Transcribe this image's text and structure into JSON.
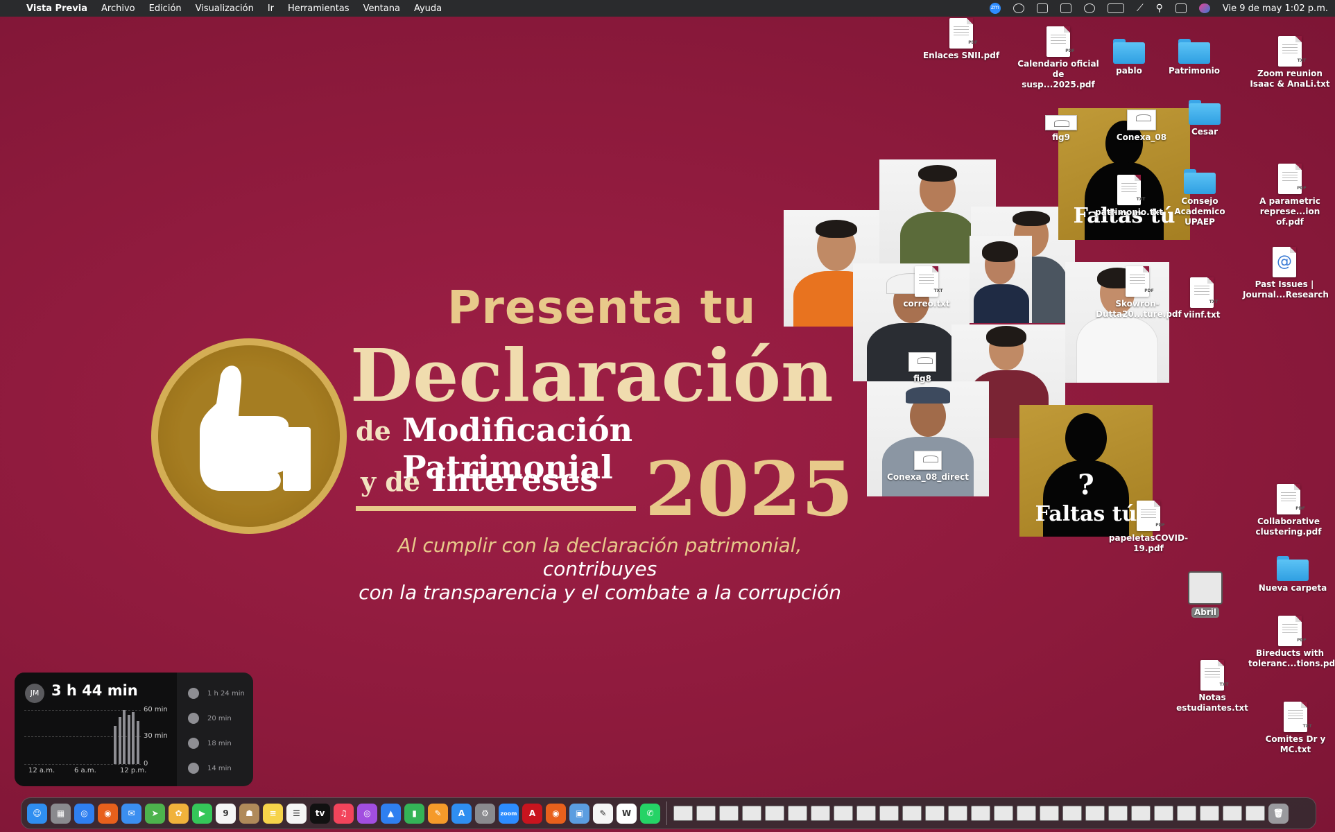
{
  "menubar": {
    "app_name": "Vista Previa",
    "menus": [
      "Archivo",
      "Edición",
      "Visualización",
      "Ir",
      "Herramientas",
      "Ventana",
      "Ayuda"
    ],
    "clock": "Vie 9 de may  1:02 p.m.",
    "status_icons": [
      "zoom-icon",
      "grammarly-icon",
      "sync-icon",
      "reader-icon",
      "play-icon",
      "battery-icon",
      "wifi-off-icon",
      "search-icon",
      "control-center-icon",
      "siri-icon"
    ]
  },
  "wallpaper": {
    "presenta": "Presenta tu",
    "declaracion": "Declaración",
    "de": "de",
    "modificacion": "Modificación Patrimonial",
    "y_de": "y de",
    "intereses": "Intereses",
    "year": "2025",
    "subtitle_gold": "Al cumplir con la declaración patrimonial,",
    "subtitle_white1": " contribuyes",
    "subtitle_white2": "con la transparencia y el combate a la corrupción",
    "faltas_1": "Faltas tú",
    "faltas_2": "Faltas tú",
    "question": "?",
    "colors": {
      "background": "#8f1a3d",
      "gold": "#e8c98a",
      "panel_gold": "#b08a2c"
    }
  },
  "desktop_icons": [
    {
      "label": "Enlaces SNII.pdf",
      "type": "pdf"
    },
    {
      "label": "Calendario oficial de susp...2025.pdf",
      "type": "pdf"
    },
    {
      "label": "pablo",
      "type": "folder"
    },
    {
      "label": "Patrimonio",
      "type": "folder"
    },
    {
      "label": "Zoom reunion Isaac & AnaLi.txt",
      "type": "txt"
    },
    {
      "label": "fig9",
      "type": "image"
    },
    {
      "label": "Conexa_08",
      "type": "image"
    },
    {
      "label": "Cesar",
      "type": "folder"
    },
    {
      "label": "patrimonio.txt",
      "type": "txt"
    },
    {
      "label": "Consejo Academico UPAEP",
      "type": "folder"
    },
    {
      "label": "A parametric represe...ion of.pdf",
      "type": "pdf"
    },
    {
      "label": "correo.txt",
      "type": "txt"
    },
    {
      "label": "Skowron-Dutta20...ture.pdf",
      "type": "pdf"
    },
    {
      "label": "viinf.txt",
      "type": "txt"
    },
    {
      "label": "Past Issues | Journal...Research",
      "type": "webloc"
    },
    {
      "label": "fig8",
      "type": "image"
    },
    {
      "label": "Conexa_08_direct",
      "type": "image"
    },
    {
      "label": "papeletasCOVID-19.pdf",
      "type": "pdf"
    },
    {
      "label": "Collaborative clustering.pdf",
      "type": "pdf"
    },
    {
      "label": "Nueva carpeta",
      "type": "folder"
    },
    {
      "label": "Abril",
      "type": "screenshot"
    },
    {
      "label": "Bireducts with toleranc...tions.pdf",
      "type": "pdf"
    },
    {
      "label": "Notas estudiantes.txt",
      "type": "txt"
    },
    {
      "label": "Comites Dr y MC.txt",
      "type": "txt"
    }
  ],
  "screen_time": {
    "avatar": "JM",
    "total": "3 h 44 min",
    "y_labels": [
      "60 min",
      "30 min",
      "0"
    ],
    "x_labels": [
      "12 a.m.",
      "6 a.m.",
      "12 p.m."
    ],
    "hourly_minutes": [
      0,
      0,
      0,
      0,
      0,
      0,
      0,
      0,
      0,
      0,
      0,
      0,
      0,
      0,
      0,
      0,
      0,
      0,
      0,
      0,
      42,
      52,
      60,
      55,
      58,
      48
    ],
    "apps": [
      {
        "time": "1 h 24 min",
        "icon": "safari-icon"
      },
      {
        "time": "20 min",
        "icon": "app-icon"
      },
      {
        "time": "18 min",
        "icon": "app-icon"
      },
      {
        "time": "14 min",
        "icon": "pencil-icon"
      }
    ]
  },
  "dock": {
    "apps": [
      {
        "name": "finder-icon",
        "color": "#2f8ef0",
        "glyph": "☺"
      },
      {
        "name": "launchpad-icon",
        "color": "#8a8a8e",
        "glyph": "▦"
      },
      {
        "name": "safari-icon",
        "color": "#2f7ff0",
        "glyph": "◎"
      },
      {
        "name": "firefox-icon",
        "color": "#e8601c",
        "glyph": "◉"
      },
      {
        "name": "mail-icon",
        "color": "#3b8ef0",
        "glyph": "✉"
      },
      {
        "name": "maps-icon",
        "color": "#4db34d",
        "glyph": "➤"
      },
      {
        "name": "photos-icon",
        "color": "#f0b23b",
        "glyph": "✿"
      },
      {
        "name": "facetime-icon",
        "color": "#35c759",
        "glyph": "▶"
      },
      {
        "name": "calendar-icon",
        "color": "#f5f5f5",
        "glyph": "9"
      },
      {
        "name": "contacts-icon",
        "color": "#b08a5a",
        "glyph": "☗"
      },
      {
        "name": "notes-icon",
        "color": "#f6d34a",
        "glyph": "≡"
      },
      {
        "name": "reminders-icon",
        "color": "#f5f5f5",
        "glyph": "☰"
      },
      {
        "name": "appletv-icon",
        "color": "#111111",
        "glyph": "tv"
      },
      {
        "name": "music-icon",
        "color": "#f2445b",
        "glyph": "♫"
      },
      {
        "name": "podcasts-icon",
        "color": "#a24ee0",
        "glyph": "◎"
      },
      {
        "name": "keynote-icon",
        "color": "#2f7ff0",
        "glyph": "▲"
      },
      {
        "name": "numbers-icon",
        "color": "#34b357",
        "glyph": "▮"
      },
      {
        "name": "pages-icon",
        "color": "#f59a2a",
        "glyph": "✎"
      },
      {
        "name": "appstore-icon",
        "color": "#2f8ef0",
        "glyph": "A"
      },
      {
        "name": "system-settings-icon",
        "color": "#8a8a8e",
        "glyph": "⚙"
      },
      {
        "name": "zoom-app-icon",
        "color": "#2d8cff",
        "glyph": "zoom"
      },
      {
        "name": "acrobat-icon",
        "color": "#c8141e",
        "glyph": "A"
      },
      {
        "name": "firefox2-icon",
        "color": "#e8601c",
        "glyph": "◉"
      },
      {
        "name": "preview-icon",
        "color": "#5b9de0",
        "glyph": "▣"
      },
      {
        "name": "textedit-icon",
        "color": "#f5f5f5",
        "glyph": "✎"
      },
      {
        "name": "word-icon",
        "color": "#ffffff",
        "glyph": "W"
      },
      {
        "name": "whatsapp-icon",
        "color": "#25d366",
        "glyph": "✆"
      }
    ],
    "minimized_windows": 26,
    "trash": "trash-icon"
  }
}
